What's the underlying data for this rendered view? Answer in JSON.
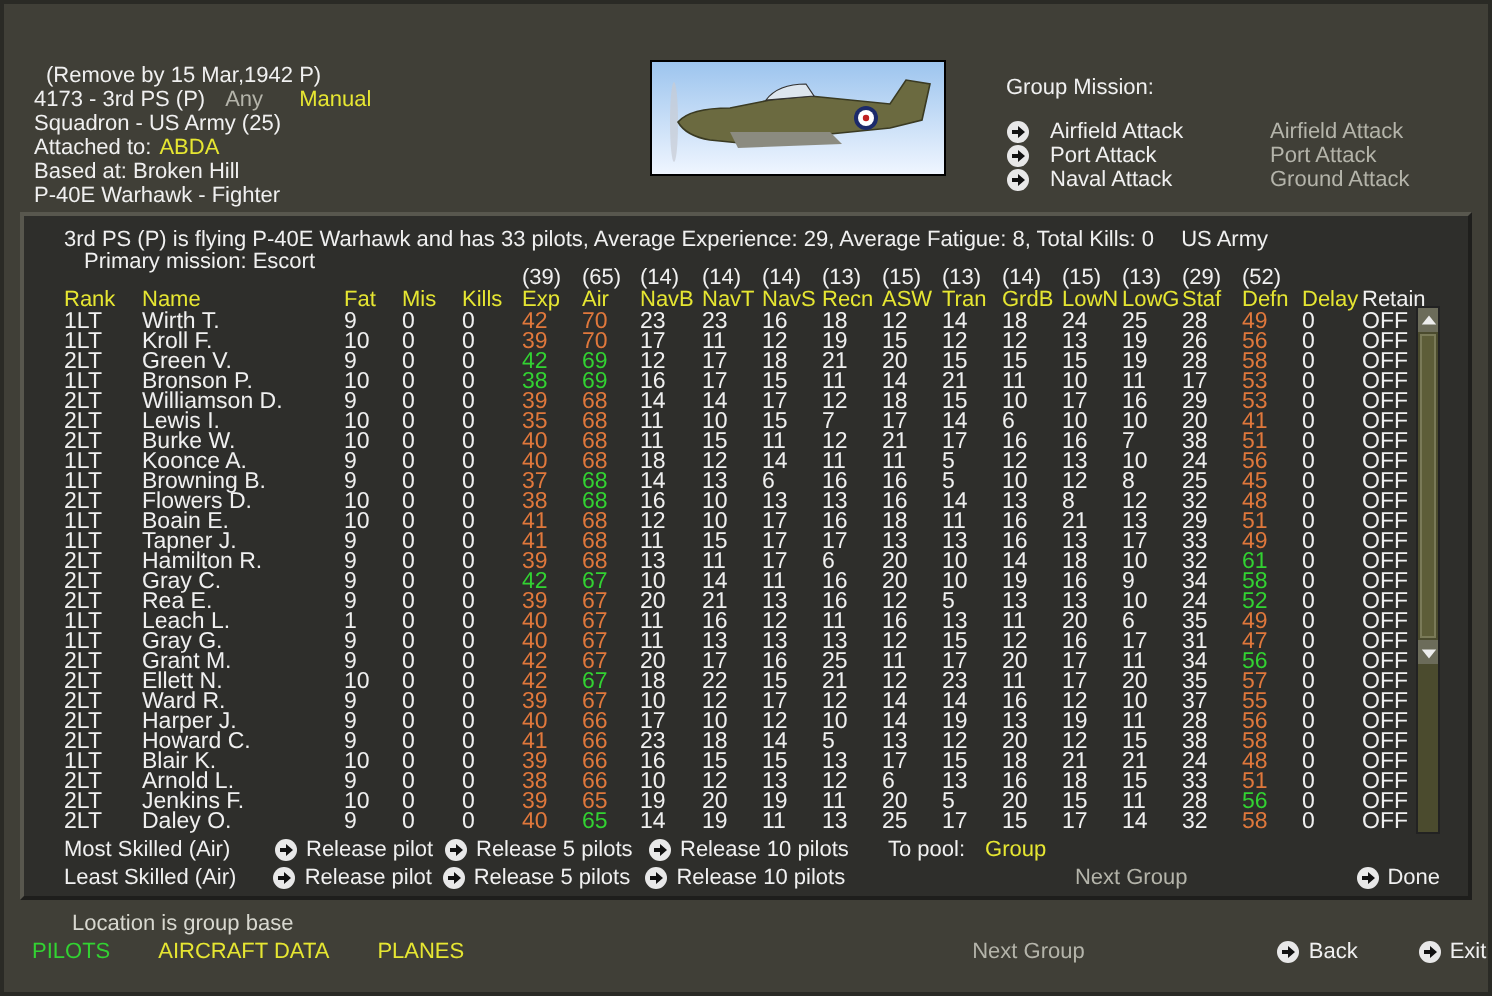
{
  "unit": {
    "remove_note": "(Remove by 15 Mar,1942  P)",
    "id_line": "4173 - 3rd PS (P)",
    "filter": "Any",
    "mode": "Manual",
    "squadron": "Squadron - US Army (25)",
    "attached_label": "Attached to:",
    "attached_value": "ABDA",
    "based": "Based at: Broken Hill",
    "aircraft": "P-40E Warhawk - Fighter"
  },
  "group_mission": {
    "title": "Group Mission:",
    "missions": [
      {
        "name": "Airfield Attack",
        "alt": "Airfield Attack"
      },
      {
        "name": "Port Attack",
        "alt": "Port Attack"
      },
      {
        "name": "Naval Attack",
        "alt": "Ground Attack"
      }
    ]
  },
  "summary": {
    "text": "3rd PS (P) is flying P-40E Warhawk and has 33 pilots,  Average Experience: 29,  Average Fatigue: 8,  Total Kills: 0",
    "service": "US Army",
    "primary_mission": "Primary mission: Escort"
  },
  "table": {
    "columns": [
      {
        "label": "Rank",
        "color": "#e6e632"
      },
      {
        "label": "Name",
        "color": "#e6e632"
      },
      {
        "label": "Fat",
        "color": "#e6e632"
      },
      {
        "label": "Mis",
        "color": "#e6e632"
      },
      {
        "label": "Kills",
        "color": "#e6e632"
      },
      {
        "label": "Exp",
        "count": "(39)",
        "color": "#e6e632"
      },
      {
        "label": "Air",
        "count": "(65)",
        "color": "#e6e632"
      },
      {
        "label": "NavB",
        "count": "(14)",
        "color": "#e6e632"
      },
      {
        "label": "NavT",
        "count": "(14)",
        "color": "#e6e632"
      },
      {
        "label": "NavS",
        "count": "(14)",
        "color": "#e6e632"
      },
      {
        "label": "Recn",
        "count": "(13)",
        "color": "#e6e632"
      },
      {
        "label": "ASW",
        "count": "(15)",
        "color": "#e6e632"
      },
      {
        "label": "Tran",
        "count": "(13)",
        "color": "#e6e632"
      },
      {
        "label": "GrdB",
        "count": "(14)",
        "color": "#e6e632"
      },
      {
        "label": "LowN",
        "count": "(15)",
        "color": "#e6e632"
      },
      {
        "label": "LowG",
        "count": "(13)",
        "color": "#e6e632"
      },
      {
        "label": "Staf",
        "count": "(29)",
        "color": "#e6e632"
      },
      {
        "label": "Defn",
        "count": "(52)",
        "color": "#e6e632"
      },
      {
        "label": "Delay",
        "color": "#e6e632"
      },
      {
        "label": "Retain",
        "color": "#f0f0f0"
      }
    ],
    "rows": [
      {
        "cells": [
          "1LT",
          "Wirth T.",
          "9",
          "0",
          "0",
          {
            "text": "42",
            "color": "#e0783c"
          },
          {
            "text": "70",
            "color": "#e0783c"
          },
          "23",
          "23",
          "16",
          "18",
          "12",
          "14",
          "18",
          "24",
          "25",
          "28",
          {
            "text": "49",
            "color": "#e0783c"
          },
          "0",
          "OFF"
        ]
      },
      {
        "cells": [
          "1LT",
          "Kroll F.",
          "10",
          "0",
          "0",
          {
            "text": "39",
            "color": "#e0783c"
          },
          {
            "text": "70",
            "color": "#e0783c"
          },
          "17",
          "11",
          "12",
          "19",
          "15",
          "12",
          "12",
          "13",
          "19",
          "26",
          {
            "text": "56",
            "color": "#e0783c"
          },
          "0",
          "OFF"
        ]
      },
      {
        "cells": [
          "2LT",
          "Green V.",
          "9",
          "0",
          "0",
          {
            "text": "42",
            "color": "#32d232"
          },
          {
            "text": "69",
            "color": "#32d232"
          },
          "12",
          "17",
          "18",
          "21",
          "20",
          "15",
          "15",
          "15",
          "19",
          "28",
          {
            "text": "58",
            "color": "#e0783c"
          },
          "0",
          "OFF"
        ]
      },
      {
        "cells": [
          "1LT",
          "Bronson P.",
          "10",
          "0",
          "0",
          {
            "text": "38",
            "color": "#32d232"
          },
          {
            "text": "69",
            "color": "#32d232"
          },
          "16",
          "17",
          "15",
          "11",
          "14",
          "21",
          "11",
          "10",
          "11",
          "17",
          {
            "text": "53",
            "color": "#e0783c"
          },
          "0",
          "OFF"
        ]
      },
      {
        "cells": [
          "2LT",
          "Williamson D.",
          "9",
          "0",
          "0",
          {
            "text": "39",
            "color": "#e0783c"
          },
          {
            "text": "68",
            "color": "#e0783c"
          },
          "14",
          "14",
          "17",
          "12",
          "18",
          "15",
          "10",
          "17",
          "16",
          "29",
          {
            "text": "53",
            "color": "#e0783c"
          },
          "0",
          "OFF"
        ]
      },
      {
        "cells": [
          "2LT",
          "Lewis I.",
          "10",
          "0",
          "0",
          {
            "text": "35",
            "color": "#e0783c"
          },
          {
            "text": "68",
            "color": "#e0783c"
          },
          "11",
          "10",
          "15",
          "7",
          "17",
          "14",
          "6",
          "10",
          "10",
          "20",
          {
            "text": "41",
            "color": "#e0783c"
          },
          "0",
          "OFF"
        ]
      },
      {
        "cells": [
          "2LT",
          "Burke W.",
          "10",
          "0",
          "0",
          {
            "text": "40",
            "color": "#e0783c"
          },
          {
            "text": "68",
            "color": "#e0783c"
          },
          "11",
          "15",
          "11",
          "12",
          "21",
          "17",
          "16",
          "16",
          "7",
          "38",
          {
            "text": "51",
            "color": "#e0783c"
          },
          "0",
          "OFF"
        ]
      },
      {
        "cells": [
          "1LT",
          "Koonce A.",
          "9",
          "0",
          "0",
          {
            "text": "40",
            "color": "#e0783c"
          },
          {
            "text": "68",
            "color": "#e0783c"
          },
          "18",
          "12",
          "14",
          "11",
          "11",
          "5",
          "12",
          "13",
          "10",
          "24",
          {
            "text": "56",
            "color": "#e0783c"
          },
          "0",
          "OFF"
        ]
      },
      {
        "cells": [
          "1LT",
          "Browning B.",
          "9",
          "0",
          "0",
          {
            "text": "37",
            "color": "#e0783c"
          },
          {
            "text": "68",
            "color": "#32d232"
          },
          "14",
          "13",
          "6",
          "16",
          "16",
          "5",
          "10",
          "12",
          "8",
          "25",
          {
            "text": "45",
            "color": "#e0783c"
          },
          "0",
          "OFF"
        ]
      },
      {
        "cells": [
          "2LT",
          "Flowers D.",
          "10",
          "0",
          "0",
          {
            "text": "38",
            "color": "#e0783c"
          },
          {
            "text": "68",
            "color": "#32d232"
          },
          "16",
          "10",
          "13",
          "13",
          "16",
          "14",
          "13",
          "8",
          "12",
          "32",
          {
            "text": "48",
            "color": "#e0783c"
          },
          "0",
          "OFF"
        ]
      },
      {
        "cells": [
          "1LT",
          "Boain E.",
          "10",
          "0",
          "0",
          {
            "text": "41",
            "color": "#e0783c"
          },
          {
            "text": "68",
            "color": "#e0783c"
          },
          "12",
          "10",
          "17",
          "16",
          "18",
          "11",
          "16",
          "21",
          "13",
          "29",
          {
            "text": "51",
            "color": "#e0783c"
          },
          "0",
          "OFF"
        ]
      },
      {
        "cells": [
          "1LT",
          "Tapner J.",
          "9",
          "0",
          "0",
          {
            "text": "41",
            "color": "#e0783c"
          },
          {
            "text": "68",
            "color": "#e0783c"
          },
          "11",
          "15",
          "17",
          "17",
          "13",
          "13",
          "16",
          "13",
          "17",
          "33",
          {
            "text": "49",
            "color": "#e0783c"
          },
          "0",
          "OFF"
        ]
      },
      {
        "cells": [
          "2LT",
          "Hamilton R.",
          "9",
          "0",
          "0",
          {
            "text": "39",
            "color": "#e0783c"
          },
          {
            "text": "68",
            "color": "#e0783c"
          },
          "13",
          "11",
          "17",
          "6",
          "20",
          "10",
          "14",
          "18",
          "10",
          "32",
          {
            "text": "61",
            "color": "#32d232"
          },
          "0",
          "OFF"
        ]
      },
      {
        "cells": [
          "2LT",
          "Gray C.",
          "9",
          "0",
          "0",
          {
            "text": "42",
            "color": "#32d232"
          },
          {
            "text": "67",
            "color": "#32d232"
          },
          "10",
          "14",
          "11",
          "16",
          "20",
          "10",
          "19",
          "16",
          "9",
          "34",
          {
            "text": "58",
            "color": "#32d232"
          },
          "0",
          "OFF"
        ]
      },
      {
        "cells": [
          "2LT",
          "Rea E.",
          "9",
          "0",
          "0",
          {
            "text": "39",
            "color": "#e0783c"
          },
          {
            "text": "67",
            "color": "#e0783c"
          },
          "20",
          "21",
          "13",
          "16",
          "12",
          "5",
          "13",
          "13",
          "10",
          "24",
          {
            "text": "52",
            "color": "#32d232"
          },
          "0",
          "OFF"
        ]
      },
      {
        "cells": [
          "1LT",
          "Leach L.",
          "1",
          "0",
          "0",
          {
            "text": "40",
            "color": "#e0783c"
          },
          {
            "text": "67",
            "color": "#e0783c"
          },
          "11",
          "16",
          "12",
          "11",
          "16",
          "13",
          "11",
          "20",
          "6",
          "35",
          {
            "text": "49",
            "color": "#e0783c"
          },
          "0",
          "OFF"
        ]
      },
      {
        "cells": [
          "1LT",
          "Gray G.",
          "9",
          "0",
          "0",
          {
            "text": "40",
            "color": "#e0783c"
          },
          {
            "text": "67",
            "color": "#e0783c"
          },
          "11",
          "13",
          "13",
          "13",
          "12",
          "15",
          "12",
          "16",
          "17",
          "31",
          {
            "text": "47",
            "color": "#e0783c"
          },
          "0",
          "OFF"
        ]
      },
      {
        "cells": [
          "2LT",
          "Grant M.",
          "9",
          "0",
          "0",
          {
            "text": "42",
            "color": "#e0783c"
          },
          {
            "text": "67",
            "color": "#e0783c"
          },
          "20",
          "17",
          "16",
          "25",
          "11",
          "17",
          "20",
          "17",
          "11",
          "34",
          {
            "text": "56",
            "color": "#32d232"
          },
          "0",
          "OFF"
        ]
      },
      {
        "cells": [
          "2LT",
          "Ellett N.",
          "10",
          "0",
          "0",
          {
            "text": "42",
            "color": "#e0783c"
          },
          {
            "text": "67",
            "color": "#32d232"
          },
          "18",
          "22",
          "15",
          "21",
          "12",
          "23",
          "11",
          "17",
          "20",
          "35",
          {
            "text": "57",
            "color": "#e0783c"
          },
          "0",
          "OFF"
        ]
      },
      {
        "cells": [
          "2LT",
          "Ward R.",
          "9",
          "0",
          "0",
          {
            "text": "39",
            "color": "#e0783c"
          },
          {
            "text": "67",
            "color": "#e0783c"
          },
          "10",
          "12",
          "17",
          "12",
          "14",
          "14",
          "16",
          "12",
          "10",
          "37",
          {
            "text": "55",
            "color": "#e0783c"
          },
          "0",
          "OFF"
        ]
      },
      {
        "cells": [
          "2LT",
          "Harper J.",
          "9",
          "0",
          "0",
          {
            "text": "40",
            "color": "#e0783c"
          },
          {
            "text": "66",
            "color": "#e0783c"
          },
          "17",
          "10",
          "12",
          "10",
          "14",
          "19",
          "13",
          "19",
          "11",
          "28",
          {
            "text": "56",
            "color": "#e0783c"
          },
          "0",
          "OFF"
        ]
      },
      {
        "cells": [
          "2LT",
          "Howard C.",
          "9",
          "0",
          "0",
          {
            "text": "41",
            "color": "#e0783c"
          },
          {
            "text": "66",
            "color": "#e0783c"
          },
          "23",
          "18",
          "14",
          "5",
          "13",
          "12",
          "20",
          "12",
          "15",
          "38",
          {
            "text": "58",
            "color": "#e0783c"
          },
          "0",
          "OFF"
        ]
      },
      {
        "cells": [
          "1LT",
          "Blair K.",
          "10",
          "0",
          "0",
          {
            "text": "39",
            "color": "#e0783c"
          },
          {
            "text": "66",
            "color": "#e0783c"
          },
          "16",
          "15",
          "15",
          "13",
          "17",
          "15",
          "18",
          "21",
          "21",
          "24",
          {
            "text": "48",
            "color": "#e0783c"
          },
          "0",
          "OFF"
        ]
      },
      {
        "cells": [
          "2LT",
          "Arnold L.",
          "9",
          "0",
          "0",
          {
            "text": "38",
            "color": "#e0783c"
          },
          {
            "text": "66",
            "color": "#e0783c"
          },
          "10",
          "12",
          "13",
          "12",
          "6",
          "13",
          "16",
          "18",
          "15",
          "33",
          {
            "text": "51",
            "color": "#e0783c"
          },
          "0",
          "OFF"
        ]
      },
      {
        "cells": [
          "2LT",
          "Jenkins F.",
          "10",
          "0",
          "0",
          {
            "text": "39",
            "color": "#e0783c"
          },
          {
            "text": "65",
            "color": "#e0783c"
          },
          "19",
          "20",
          "19",
          "11",
          "20",
          "5",
          "20",
          "15",
          "11",
          "28",
          {
            "text": "56",
            "color": "#32d232"
          },
          "0",
          "OFF"
        ]
      },
      {
        "cells": [
          "2LT",
          "Daley O.",
          "9",
          "0",
          "0",
          {
            "text": "40",
            "color": "#e0783c"
          },
          {
            "text": "65",
            "color": "#32d232"
          },
          "14",
          "19",
          "11",
          "13",
          "25",
          "17",
          "15",
          "17",
          "14",
          "32",
          {
            "text": "58",
            "color": "#e0783c"
          },
          "0",
          "OFF"
        ]
      }
    ]
  },
  "release_rows": [
    {
      "label": "Most Skilled (Air)",
      "actions": [
        "Release pilot",
        "Release 5 pilots",
        "Release 10 pilots"
      ]
    },
    {
      "label": "Least Skilled (Air)",
      "actions": [
        "Release pilot",
        "Release 5 pilots",
        "Release 10 pilots"
      ]
    }
  ],
  "pool": {
    "label": "To pool:",
    "value": "Group"
  },
  "panel_next_group": "Next Group",
  "done": "Done",
  "location": "Location is group base",
  "tabs": [
    {
      "label": "PILOTS",
      "selected": true
    },
    {
      "label": "AIRCRAFT DATA",
      "selected": false
    },
    {
      "label": "PLANES",
      "selected": false
    }
  ],
  "footer": {
    "next_group": "Next Group",
    "back": "Back",
    "exit": "Exit"
  }
}
